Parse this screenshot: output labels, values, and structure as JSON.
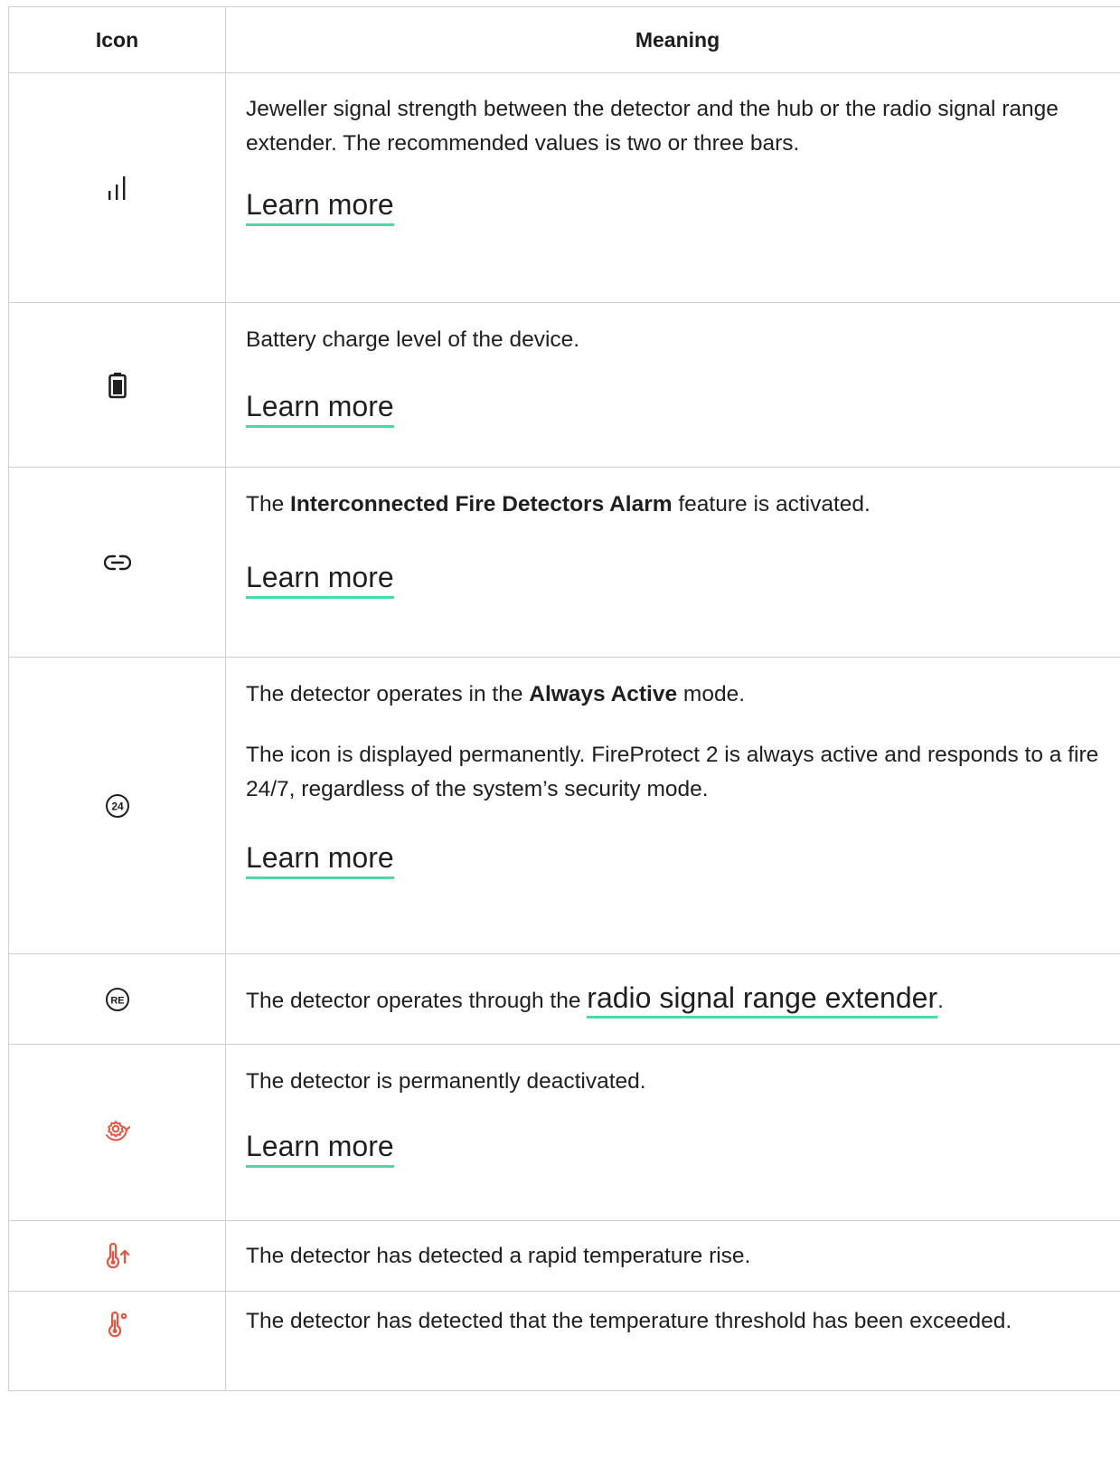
{
  "table": {
    "header_icon": "Icon",
    "header_meaning": "Meaning",
    "rows": [
      {
        "icon": "signal-strength-icon",
        "p1": "Jeweller signal strength between the detector and the hub or the radio signal range extender. The recommended values is two or three bars.",
        "link": "Learn more"
      },
      {
        "icon": "battery-icon",
        "p1": "Battery charge level of the device.",
        "link": "Learn more"
      },
      {
        "icon": "link-icon",
        "p1_pre": "The ",
        "p1_bold": "Interconnected Fire Detectors Alarm",
        "p1_post": " feature is activated.",
        "link": "Learn more"
      },
      {
        "icon": "always-active-24-icon",
        "icon_text": "24",
        "p1_pre": "The detector operates in the ",
        "p1_bold": "Always Active",
        "p1_post": " mode.",
        "p2": "The icon is displayed permanently. FireProtect 2 is always active and responds to a fire 24/7, regardless of the system’s security mode.",
        "link": "Learn more"
      },
      {
        "icon": "range-extender-re-icon",
        "icon_text": "RE",
        "p1_pre": "The detector operates through the ",
        "p1_link": "radio signal range extender",
        "p1_post": "."
      },
      {
        "icon": "deactivated-gear-icon",
        "p1": "The detector is permanently deactivated.",
        "link": "Learn more"
      },
      {
        "icon": "temperature-rise-icon",
        "p1": "The detector has detected a rapid temperature rise."
      },
      {
        "icon": "temperature-threshold-icon",
        "p1": "The detector has detected that the temperature threshold has been exceeded."
      }
    ]
  },
  "colors": {
    "link_underline": "#4fd8a4",
    "alert_icon": "#e8553e",
    "border": "#cfcfcf",
    "text": "#1f1f1f"
  }
}
